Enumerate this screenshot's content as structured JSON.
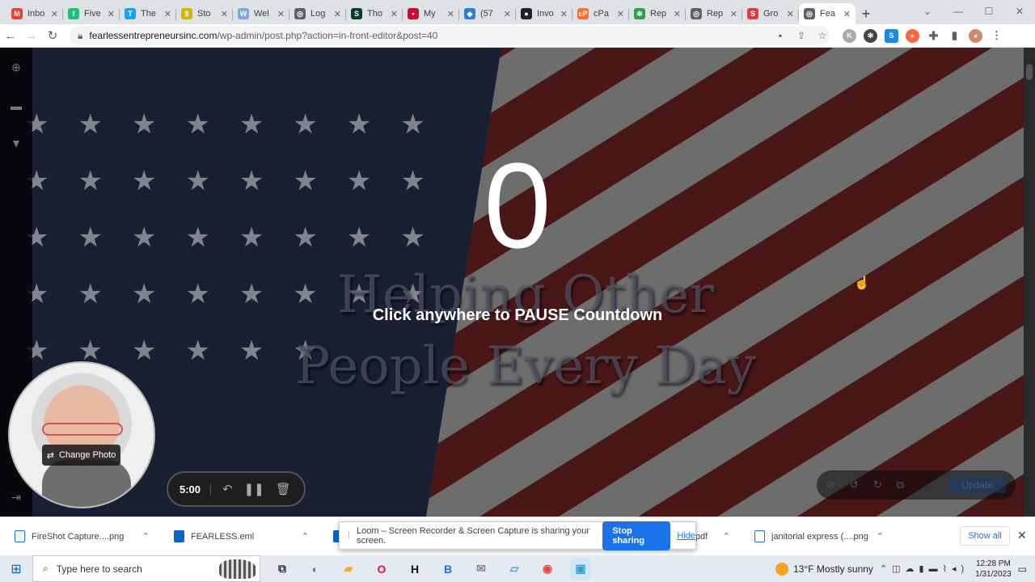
{
  "browser": {
    "tabs": [
      {
        "title": "Inbo",
        "icon": "gmail-icon",
        "color": "#ea4335",
        "glyph": "M"
      },
      {
        "title": "Five",
        "icon": "fiverr-icon",
        "color": "#1dbf73",
        "glyph": "f"
      },
      {
        "title": "The",
        "icon": "t-icon",
        "color": "#1da1f2",
        "glyph": "T"
      },
      {
        "title": "Sto",
        "icon": "dollar-icon",
        "color": "#d4b300",
        "glyph": "$"
      },
      {
        "title": "Wel",
        "icon": "wordpress-icon",
        "color": "#7aa8d8",
        "glyph": "W"
      },
      {
        "title": "Log",
        "icon": "globe-icon",
        "color": "#5f6368",
        "glyph": "◎"
      },
      {
        "title": "Tho",
        "icon": "s-icon",
        "color": "#0b3d2c",
        "glyph": "S"
      },
      {
        "title": "My",
        "icon": "red-square-icon",
        "color": "#c8102e",
        "glyph": "▪"
      },
      {
        "title": "(57",
        "icon": "cloud-icon",
        "color": "#2b7bd8",
        "glyph": "◆"
      },
      {
        "title": "Invo",
        "icon": "dark-circle-icon",
        "color": "#222222",
        "glyph": "●"
      },
      {
        "title": "cPa",
        "icon": "cpanel-icon",
        "color": "#ff6c2c",
        "glyph": "cP"
      },
      {
        "title": "Rep",
        "icon": "gear-green-icon",
        "color": "#2d9d4a",
        "glyph": "✻"
      },
      {
        "title": "Rep",
        "icon": "globe-icon",
        "color": "#5f6368",
        "glyph": "◎"
      },
      {
        "title": "Gro",
        "icon": "s-red-icon",
        "color": "#e0393e",
        "glyph": "S"
      },
      {
        "title": "Fea",
        "icon": "globe-icon",
        "color": "#5f6368",
        "glyph": "◎",
        "active": true
      }
    ],
    "url_host": "fearlessentrepreneursinc.com",
    "url_path": "/wp-admin/post.php?action=in-front-editor&post=40"
  },
  "hero": {
    "countdown": "0",
    "headline_line1": "Helping Other",
    "headline_line2": "People Every Day",
    "pause_message": "Click anywhere to PAUSE Countdown"
  },
  "loom_widget": {
    "change_photo": "Change Photo",
    "timer": "5:00"
  },
  "editor": {
    "update_label": "Update"
  },
  "downloads": {
    "items": [
      {
        "name": "FireShot Capture....png",
        "type": "file"
      },
      {
        "name": "FEARLESS.eml",
        "type": "outlook"
      },
      {
        "name": "oodstandi....pdf",
        "type": "file"
      },
      {
        "name": "janitorial express (....png",
        "type": "file"
      }
    ],
    "show_all": "Show all"
  },
  "loom_banner": {
    "message": "Loom – Screen Recorder & Screen Capture is sharing your screen.",
    "stop_label": "Stop sharing",
    "hide_label": "Hide"
  },
  "taskbar": {
    "search_placeholder": "Type here to search",
    "weather": "13°F  Mostly sunny",
    "time": "12:28 PM",
    "date": "1/31/2023"
  }
}
